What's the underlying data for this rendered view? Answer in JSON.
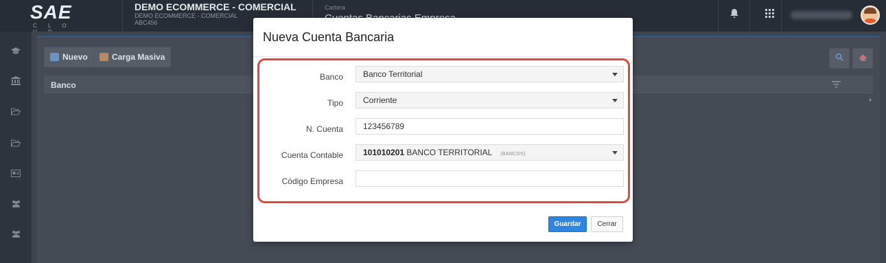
{
  "header": {
    "logo_text": "SAE",
    "logo_sub": "C L O U D",
    "company_name": "DEMO ECOMMERCE - COMERCIAL",
    "company_sub": "DEMO ECOMMERCE - COMERCIAL",
    "company_code": "ABC456",
    "section_small": "Cartera",
    "section_title": "Cuentas Bancarias Empresa"
  },
  "toolbar": {
    "nuevo_label": "Nuevo",
    "carga_masiva_label": "Carga Masiva"
  },
  "grid": {
    "column_banco": "Banco"
  },
  "modal": {
    "title": "Nueva Cuenta Bancaria",
    "fields": {
      "banco": {
        "label": "Banco",
        "value": "Banco Territorial"
      },
      "tipo": {
        "label": "Tipo",
        "value": "Corriente"
      },
      "n_cuenta": {
        "label": "N. Cuenta",
        "value": "123456789"
      },
      "cuenta_contable": {
        "label": "Cuenta Contable",
        "code": "101010201",
        "name": "BANCO TERRITORIAL",
        "tag": "(BANCOS)"
      },
      "codigo_empresa": {
        "label": "Código Empresa",
        "value": ""
      }
    },
    "save_label": "Guardar",
    "close_label": "Cerrar"
  },
  "colors": {
    "highlight": "#dc4a3b",
    "primary": "#2e86de"
  },
  "icons": [
    "graduation-cap-icon",
    "bank-icon",
    "folder-icon",
    "id-card-icon",
    "users-icon",
    "bell-icon",
    "apps-grid-icon",
    "search-icon",
    "eraser-icon",
    "filter-icon"
  ]
}
